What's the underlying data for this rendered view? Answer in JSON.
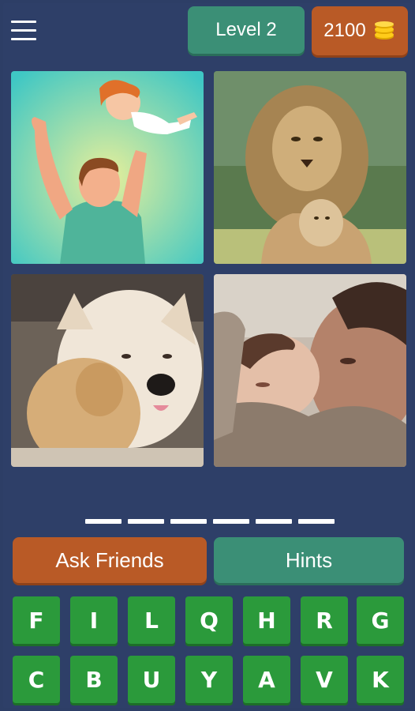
{
  "header": {
    "level_label": "Level 2",
    "coins": "2100",
    "menu_icon": "hamburger-menu-icon",
    "coin_icon": "coin-stack-icon"
  },
  "answer": {
    "length": 6
  },
  "actions": {
    "ask_friends": "Ask Friends",
    "hints": "Hints"
  },
  "keyboard": {
    "row1": [
      "F",
      "I",
      "L",
      "Q",
      "H",
      "R",
      "G"
    ],
    "row2": [
      "C",
      "B",
      "U",
      "Y",
      "A",
      "V",
      "K"
    ]
  },
  "colors": {
    "background": "#2e3f68",
    "green_button": "#3b8f76",
    "orange_button": "#b95a26",
    "key_green": "#2b9a3b"
  }
}
